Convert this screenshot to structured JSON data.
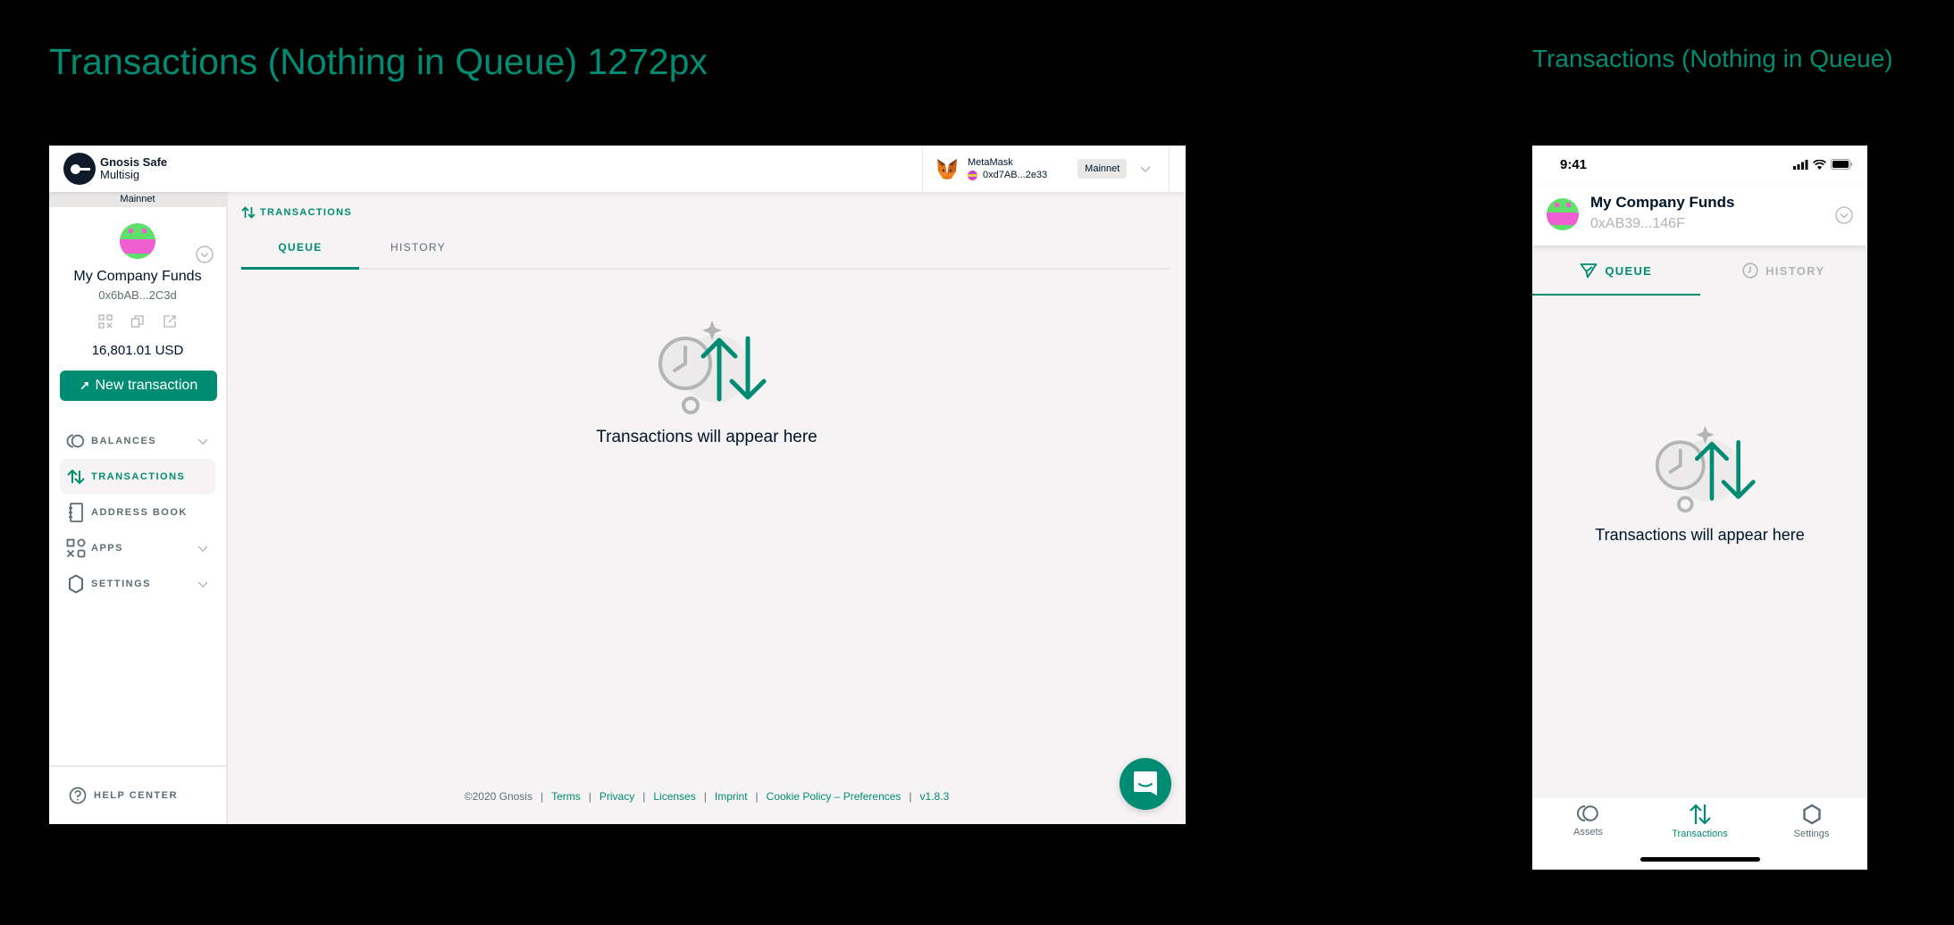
{
  "artboards": {
    "desktop_title": "Transactions (Nothing in Queue) 1272px",
    "mobile_title": "Transactions (Nothing in Queue)"
  },
  "desktop": {
    "logo": {
      "line1": "Gnosis Safe",
      "line2": "Multisig"
    },
    "wallet": {
      "provider": "MetaMask",
      "address": "0xd7AB...2e33",
      "network": "Mainnet",
      "icon": "metamask-fox-icon"
    },
    "sidebar": {
      "network_label": "Mainnet",
      "safe_name": "My Company Funds",
      "safe_address": "0x6bAB...2C3d",
      "actions": [
        "qr-code-icon",
        "copy-icon",
        "external-link-icon"
      ],
      "balance": "16,801.01 USD",
      "new_tx_label": "New transaction",
      "items": [
        {
          "label": "BALANCES",
          "icon": "coins-icon",
          "expandable": true,
          "active": false
        },
        {
          "label": "TRANSACTIONS",
          "icon": "transactions-icon",
          "expandable": false,
          "active": true
        },
        {
          "label": "ADDRESS BOOK",
          "icon": "address-book-icon",
          "expandable": false,
          "active": false
        },
        {
          "label": "APPS",
          "icon": "apps-icon",
          "expandable": true,
          "active": false
        },
        {
          "label": "SETTINGS",
          "icon": "settings-icon",
          "expandable": true,
          "active": false
        }
      ],
      "help_label": "HELP CENTER"
    },
    "main": {
      "heading": "TRANSACTIONS",
      "tabs": [
        {
          "label": "QUEUE",
          "active": true
        },
        {
          "label": "HISTORY",
          "active": false
        }
      ],
      "empty_text": "Transactions will appear here"
    },
    "footer": {
      "copyright": "©2020 Gnosis",
      "links": [
        "Terms",
        "Privacy",
        "Licenses",
        "Imprint",
        "Cookie Policy",
        "Preferences"
      ],
      "cookie_separator": " – ",
      "version": "v1.8.3"
    }
  },
  "mobile": {
    "time": "9:41",
    "safe_name": "My Company Funds",
    "safe_address": "0xAB39...146F",
    "tabs": [
      {
        "label": "QUEUE",
        "icon": "send-icon",
        "active": true
      },
      {
        "label": "HISTORY",
        "icon": "clock-icon",
        "active": false
      }
    ],
    "empty_text": "Transactions will appear here",
    "tabbar": [
      {
        "label": "Assets",
        "icon": "coins-icon",
        "active": false
      },
      {
        "label": "Transactions",
        "icon": "transactions-icon",
        "active": true
      },
      {
        "label": "Settings",
        "icon": "settings-icon",
        "active": false
      }
    ]
  },
  "colors": {
    "accent": "#008c73",
    "text": "#001428",
    "muted": "#5d6d74",
    "background": "#f5f3f4",
    "border": "#e8e7e6"
  }
}
